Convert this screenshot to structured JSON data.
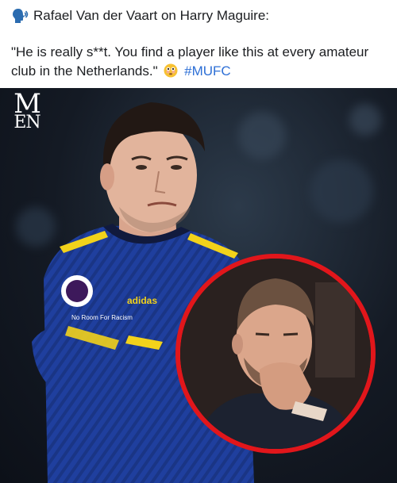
{
  "post": {
    "head_icon": "speaking-head-icon",
    "headline": "Rafael Van der Vaart on Harry Maguire:",
    "quote_line1": "\"He is really s**t. You find a player like this at every amateur",
    "quote_line2": "club in the Netherlands.\"",
    "emoji": "flushed-face-emoji",
    "hashtag": "#MUFC"
  },
  "photo": {
    "logo_line1": "M",
    "logo_line2": "EN",
    "sponsor_text": "adidas",
    "chest_text": "No Room For Racism"
  },
  "colors": {
    "hashtag": "#2d6fd6",
    "inset_border": "#e1161b",
    "kit_blue": "#1f3f9e",
    "kit_yellow": "#f2d21b"
  }
}
